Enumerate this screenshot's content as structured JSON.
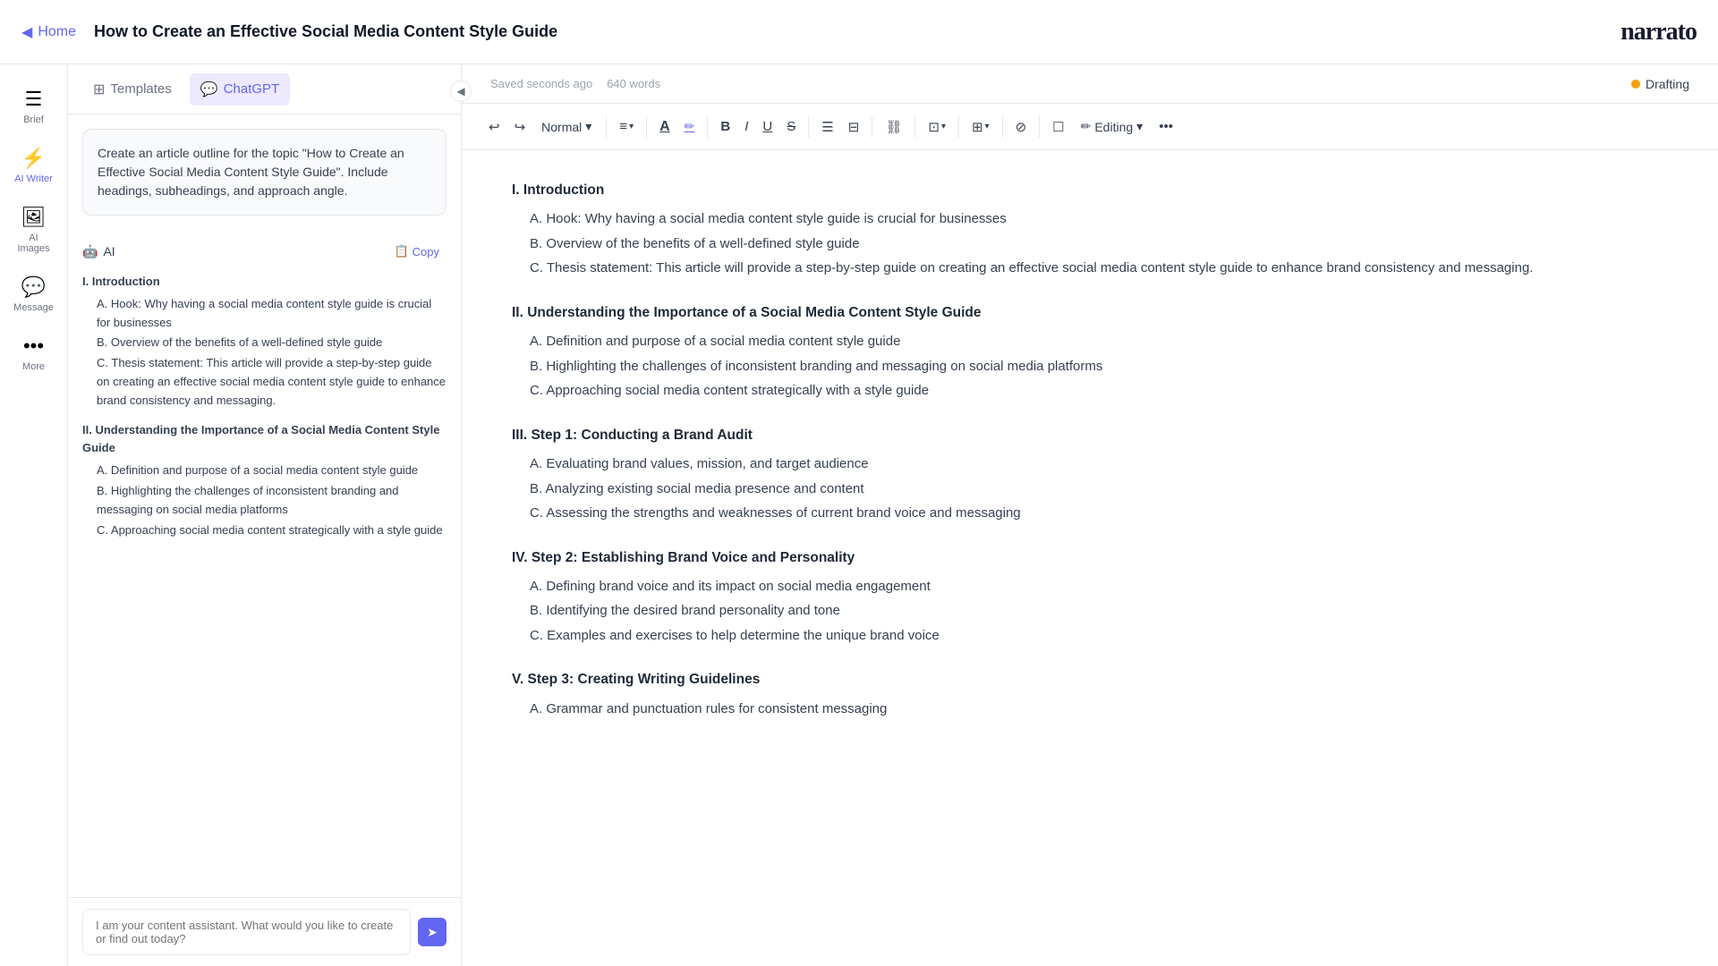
{
  "header": {
    "home_label": "Home",
    "page_title": "How to Create an Effective Social Media Content Style Guide",
    "logo": "narrato"
  },
  "sidebar": {
    "items": [
      {
        "id": "brief",
        "icon": "☰",
        "label": "Brief"
      },
      {
        "id": "ai-writer",
        "icon": "⚡",
        "label": "AI Writer"
      },
      {
        "id": "ai-images",
        "icon": "🖼",
        "label": "AI Images"
      },
      {
        "id": "message",
        "icon": "💬",
        "label": "Message"
      },
      {
        "id": "more",
        "icon": "···",
        "label": "More"
      }
    ]
  },
  "panel": {
    "tabs": [
      {
        "id": "templates",
        "icon": "⊞",
        "label": "Templates"
      },
      {
        "id": "chatgpt",
        "icon": "💬",
        "label": "ChatGPT"
      }
    ],
    "active_tab": "chatgpt",
    "prompt_text": "Create an article outline for the topic \"How to Create an Effective Social Media Content Style Guide\". Include headings, subheadings, and approach angle.",
    "ai_label": "AI",
    "copy_label": "Copy",
    "ai_content": [
      {
        "type": "section",
        "heading": "I. Introduction",
        "items": [
          "A. Hook: Why having a social media content style guide is crucial for businesses",
          "B. Overview of the benefits of a well-defined style guide",
          "C. Thesis statement: This article will provide a step-by-step guide on creating an effective social media content style guide to enhance brand consistency and messaging."
        ]
      },
      {
        "type": "section",
        "heading": "II. Understanding the Importance of a Social Media Content Style Guide",
        "items": [
          "A. Definition and purpose of a social media content style guide",
          "B. Highlighting the challenges of inconsistent branding and messaging on social media platforms",
          "C. Approaching social media content strategically with a style guide"
        ]
      }
    ],
    "chat_placeholder": "I am your content assistant. What would you like to create or find out today?"
  },
  "editor": {
    "saved_status": "Saved seconds ago",
    "word_count": "640 words",
    "drafting_label": "Drafting",
    "style_label": "Normal",
    "editing_label": "Editing",
    "toolbar": {
      "undo": "↩",
      "redo": "↪",
      "align": "≡",
      "text_color": "A",
      "highlight": "✏",
      "bold": "B",
      "italic": "I",
      "underline": "U",
      "strikethrough": "S",
      "bullet_list": "≡",
      "numbered_list": "≡",
      "link": "⛓",
      "image": "⊡",
      "table": "⊞",
      "more": "···"
    },
    "content": {
      "sections": [
        {
          "heading": "I. Introduction",
          "items": [
            "A. Hook: Why having a social media content style guide is crucial for businesses",
            "B. Overview of the benefits of a well-defined style guide",
            "C. Thesis statement: This article will provide a step-by-step guide on creating an effective social media content style guide to enhance brand consistency and messaging."
          ]
        },
        {
          "heading": "II. Understanding the Importance of a Social Media Content Style Guide",
          "items": [
            "A. Definition and purpose of a social media content style guide",
            "B. Highlighting the challenges of inconsistent branding and messaging on social media platforms",
            "C. Approaching social media content strategically with a style guide"
          ]
        },
        {
          "heading": "III. Step 1: Conducting a Brand Audit",
          "items": [
            "A. Evaluating brand values, mission, and target audience",
            "B. Analyzing existing social media presence and content",
            "C. Assessing the strengths and weaknesses of current brand voice and messaging"
          ]
        },
        {
          "heading": "IV. Step 2: Establishing Brand Voice and Personality",
          "items": [
            "A. Defining brand voice and its impact on social media engagement",
            "B. Identifying the desired brand personality and tone",
            "C. Examples and exercises to help determine the unique brand voice"
          ]
        },
        {
          "heading": "V. Step 3: Creating Writing Guidelines",
          "items": [
            "A. Grammar and punctuation rules for consistent messaging"
          ]
        }
      ]
    }
  }
}
